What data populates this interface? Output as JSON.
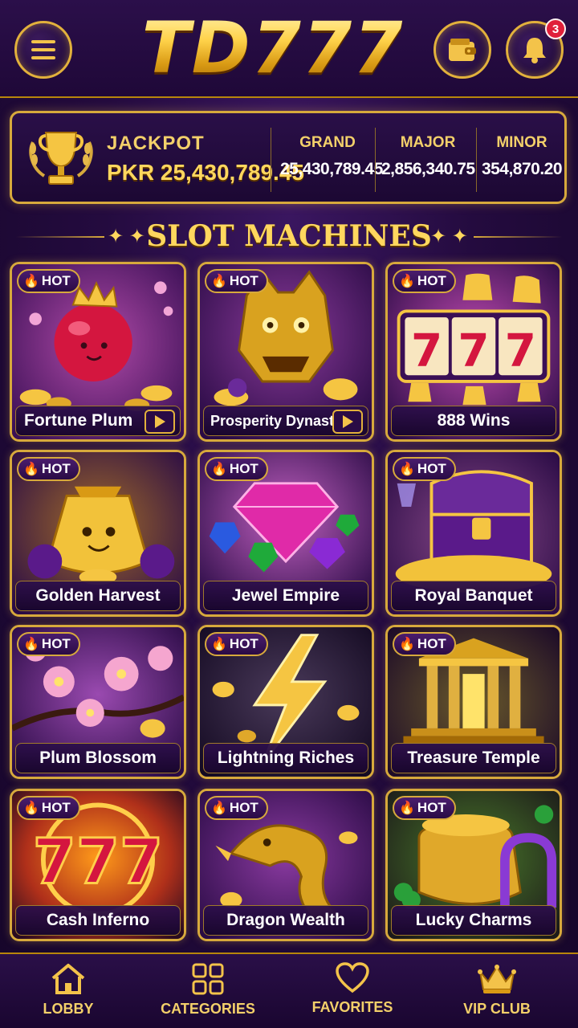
{
  "header": {
    "logo_text": "TD777",
    "menu_icon": "hamburger-menu-icon",
    "wallet_icon": "wallet-icon",
    "bell_icon": "bell-icon",
    "notification_count": "3"
  },
  "jackpot": {
    "label": "JACKPOT",
    "amount": "PKR 25,430,789.45",
    "tiers": [
      {
        "name": "GRAND",
        "value": "25,430,789.45"
      },
      {
        "name": "MAJOR",
        "value": "2,856,340.75"
      },
      {
        "name": "MINOR",
        "value": "354,870.20"
      }
    ]
  },
  "section": {
    "title": "SLOT MACHINES"
  },
  "games": [
    {
      "name": "Fortune Plum",
      "badge": "HOT",
      "has_play": true
    },
    {
      "name": "Prosperity Dynasty",
      "badge": "HOT",
      "has_play": true
    },
    {
      "name": "888 Wins",
      "badge": "HOT",
      "has_play": false
    },
    {
      "name": "Golden Harvest",
      "badge": "HOT",
      "has_play": false
    },
    {
      "name": "Jewel Empire",
      "badge": "HOT",
      "has_play": false
    },
    {
      "name": "Royal Banquet",
      "badge": "HOT",
      "has_play": false
    },
    {
      "name": "Plum Blossom",
      "badge": "HOT",
      "has_play": false
    },
    {
      "name": "Lightning Riches",
      "badge": "HOT",
      "has_play": false
    },
    {
      "name": "Treasure Temple",
      "badge": "HOT",
      "has_play": false
    },
    {
      "name": "Cash Inferno",
      "badge": "HOT",
      "has_play": false
    },
    {
      "name": "Dragon Wealth",
      "badge": "HOT",
      "has_play": false
    },
    {
      "name": "Lucky Charms",
      "badge": "HOT",
      "has_play": false
    }
  ],
  "nav": [
    {
      "label": "LOBBY",
      "icon": "home-icon"
    },
    {
      "label": "CATEGORIES",
      "icon": "grid-icon"
    },
    {
      "label": "FAVORITES",
      "icon": "heart-icon"
    },
    {
      "label": "VIP CLUB",
      "icon": "crown-icon"
    }
  ],
  "colors": {
    "accent_gold": "#d7a93c",
    "background": "#240b3f",
    "badge_red": "#e0203a"
  }
}
